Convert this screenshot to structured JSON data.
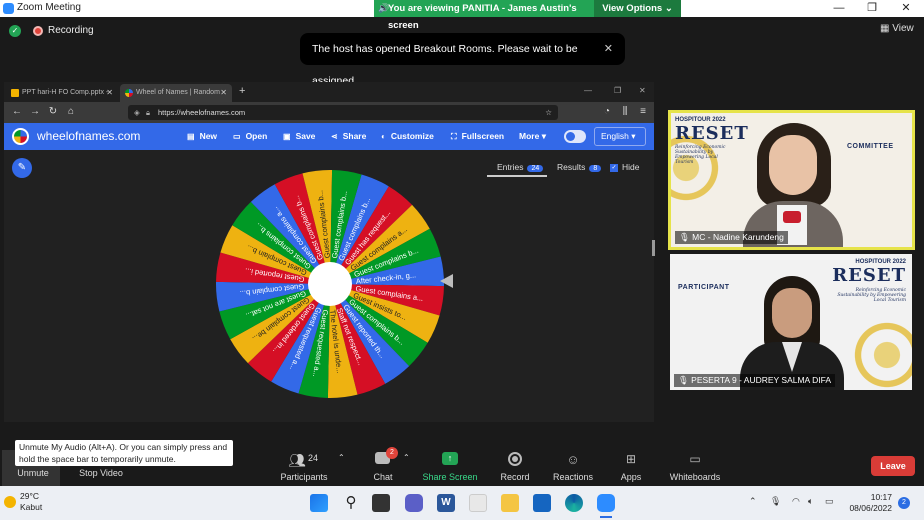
{
  "window": {
    "title": "Zoom Meeting",
    "share_banner": "You are viewing PANITIA - James Austin's screen",
    "view_options": "View Options",
    "minimize": "—",
    "maximize": "❐",
    "close": "✕"
  },
  "status": {
    "recording": "Recording",
    "view": "View"
  },
  "toast": {
    "message": "The host has opened Breakout Rooms. Please wait to be assigned.",
    "close": "✕"
  },
  "browser": {
    "tabs": [
      {
        "label": "PPT hari-H FO Comp.pptx - Go",
        "active": false
      },
      {
        "label": "Wheel of Names | Random nam",
        "active": true
      }
    ],
    "url": "https://wheelofnames.com"
  },
  "wheelofnames": {
    "brand": "wheelofnames.com",
    "toolbar": {
      "new": "New",
      "open": "Open",
      "save": "Save",
      "share": "Share",
      "customize": "Customize",
      "fullscreen": "Fullscreen",
      "more": "More",
      "language": "English"
    },
    "panel": {
      "entries_label": "Entries",
      "entries_count": "24",
      "results_label": "Results",
      "results_count": "8",
      "hide_label": "Hide"
    },
    "colors": [
      "#3369e8",
      "#d50f25",
      "#eeb211",
      "#009925"
    ],
    "segments": [
      "Guest complains b...",
      "Guest has request...",
      "Guest complains a...",
      "Guest complains b...",
      "After check-in, g...",
      "Guest complains a...",
      "Guest insists to...",
      "Guest complains b...",
      "Guest reported th...",
      "Staff not respect...",
      "The hotel is unde...",
      "Guest requested a...",
      "Guest requested a...",
      "Guest ordered in...",
      "Guest complain be...",
      "Guest are not sat...",
      "Guest complain b...",
      "Guest reported i...",
      "Guest complain b...",
      "Guest complains b...",
      "Guest complains a...",
      "Guest complains b...",
      "Guest complains b...",
      "Guest complains b..."
    ]
  },
  "videos": {
    "mc": {
      "name": "MC - Nadine Karundeng",
      "event": "HOSPITOUR 2022",
      "logo": "RESET",
      "tagline": "Reinforcing Economic Sustainability by Empowering Local Tourism",
      "role": "COMMITTEE"
    },
    "participant": {
      "name": "PESERTA 9 - AUDREY SALMA DIFA",
      "event": "HOSPITOUR 2022",
      "logo": "RESET",
      "tagline": "Reinforcing Economic Sustainability by Empowering Local Tourism",
      "role": "PARTICIPANT"
    }
  },
  "tooltip": "Unmute My Audio (Alt+A). Or you can simply press and hold the space bar to temporarily unmute.",
  "toolbar": {
    "unmute": "Unmute",
    "stop_video": "Stop Video",
    "participants": "Participants",
    "participants_count": "24",
    "chat": "Chat",
    "chat_badge": "2",
    "share_screen": "Share Screen",
    "record": "Record",
    "reactions": "Reactions",
    "apps": "Apps",
    "whiteboards": "Whiteboards",
    "leave": "Leave"
  },
  "taskbar": {
    "temperature": "29°C",
    "weather": "Kabut",
    "time": "10:17",
    "date": "08/06/2022",
    "notifications": "2"
  }
}
